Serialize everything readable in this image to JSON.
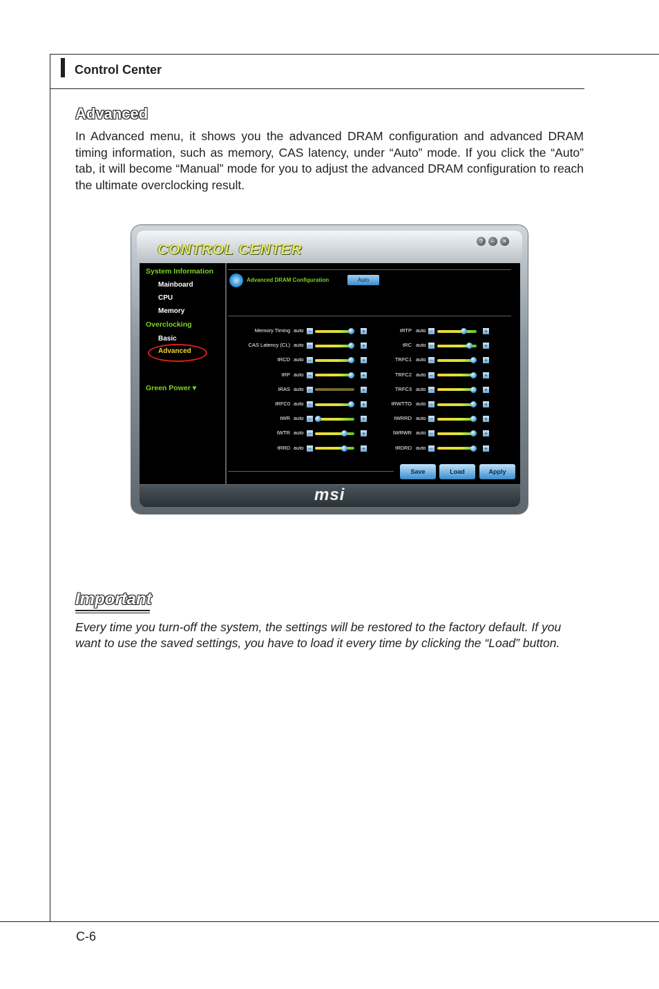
{
  "header": {
    "title": "Control Center"
  },
  "section": {
    "title": "Advanced",
    "body": "In Advanced menu, it shows you the advanced DRAM configuration and advanced DRAM timing information, such as memory, CAS latency, under “Auto” mode. If you click the “Auto” tab, it will become “Manual” mode for you to adjust the advanced DRAM configuration to reach the ultimate overclocking result."
  },
  "app": {
    "logo": "CONTROL CENTER",
    "window_buttons": [
      "?",
      "–",
      "×"
    ],
    "sidebar": {
      "system_information": "System Information",
      "mainboard": "Mainboard",
      "cpu": "CPU",
      "memory": "Memory",
      "overclocking": "Overclocking",
      "basic": "Basic",
      "advanced": "Advanced",
      "green_power": "Green Power ▾"
    },
    "panel_title": "Advanced DRAM Configuration",
    "auto_button": "Auto",
    "rows_left": [
      {
        "label": "Memory Timing",
        "value": "auto",
        "level": 0.92
      },
      {
        "label": "CAS Latency (CL)",
        "value": "auto",
        "level": 0.92
      },
      {
        "label": "tRCD",
        "value": "auto",
        "level": 0.92
      },
      {
        "label": "tRP",
        "value": "auto",
        "level": 0.92
      },
      {
        "label": "tRAS",
        "value": "auto",
        "level": 1.0
      },
      {
        "label": "tRFC0",
        "value": "auto",
        "level": 0.92
      },
      {
        "label": "tWR",
        "value": "auto",
        "level": 0.08
      },
      {
        "label": "tWTR",
        "value": "auto",
        "level": 0.75
      },
      {
        "label": "tRRD",
        "value": "auto",
        "level": 0.75
      }
    ],
    "rows_right": [
      {
        "label": "tRTP",
        "value": "auto",
        "level": 0.68
      },
      {
        "label": "tRC",
        "value": "auto",
        "level": 0.82
      },
      {
        "label": "TRFC1",
        "value": "auto",
        "level": 0.92
      },
      {
        "label": "TRFC2",
        "value": "auto",
        "level": 0.92
      },
      {
        "label": "TRFC3",
        "value": "auto",
        "level": 0.92
      },
      {
        "label": "tRWTTO",
        "value": "auto",
        "level": 0.92
      },
      {
        "label": "tWRRD",
        "value": "auto",
        "level": 0.92
      },
      {
        "label": "tWRWR",
        "value": "auto",
        "level": 0.92
      },
      {
        "label": "tRDRD",
        "value": "auto",
        "level": 0.92
      }
    ],
    "minus": "–",
    "plus": "+",
    "buttons": {
      "save": "Save",
      "load": "Load",
      "apply": "Apply"
    },
    "brand": "msi"
  },
  "important": {
    "heading": "Important",
    "text": "Every time you turn-off the system, the settings will be restored to the factory default. If you want to use the saved settings, you have to load it every time by clicking the “Load” button."
  },
  "page_number": "C-6"
}
